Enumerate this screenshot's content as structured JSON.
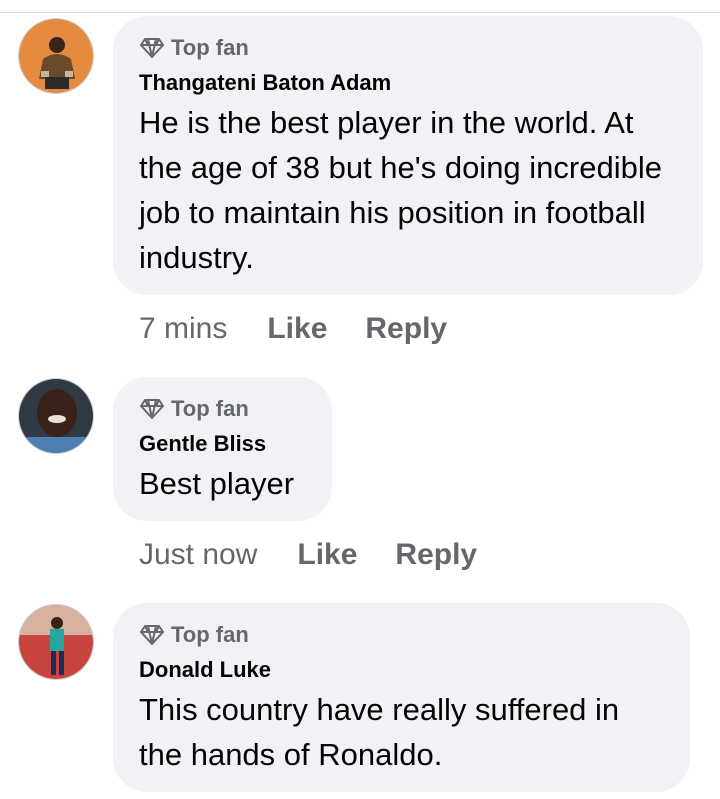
{
  "comments": [
    {
      "badge": "Top fan",
      "author": "Thangateni Baton Adam",
      "text": "He is the best player in the world. At the age of 38 but he's doing incredible job to maintain his position in football industry.",
      "time": "7 mins",
      "like": "Like",
      "reply": "Reply"
    },
    {
      "badge": "Top fan",
      "author": "Gentle Bliss",
      "text": "Best player",
      "time": "Just now",
      "like": "Like",
      "reply": "Reply"
    },
    {
      "badge": "Top fan",
      "author": "Donald Luke",
      "text": "This country have really suffered in the hands of Ronaldo.",
      "time": "",
      "like": "",
      "reply": ""
    }
  ],
  "colors": {
    "bubble": "#f0f2f5",
    "secondary_text": "#65676b",
    "primary_text": "#050505"
  },
  "icons": {
    "badge": "diamond-icon"
  }
}
